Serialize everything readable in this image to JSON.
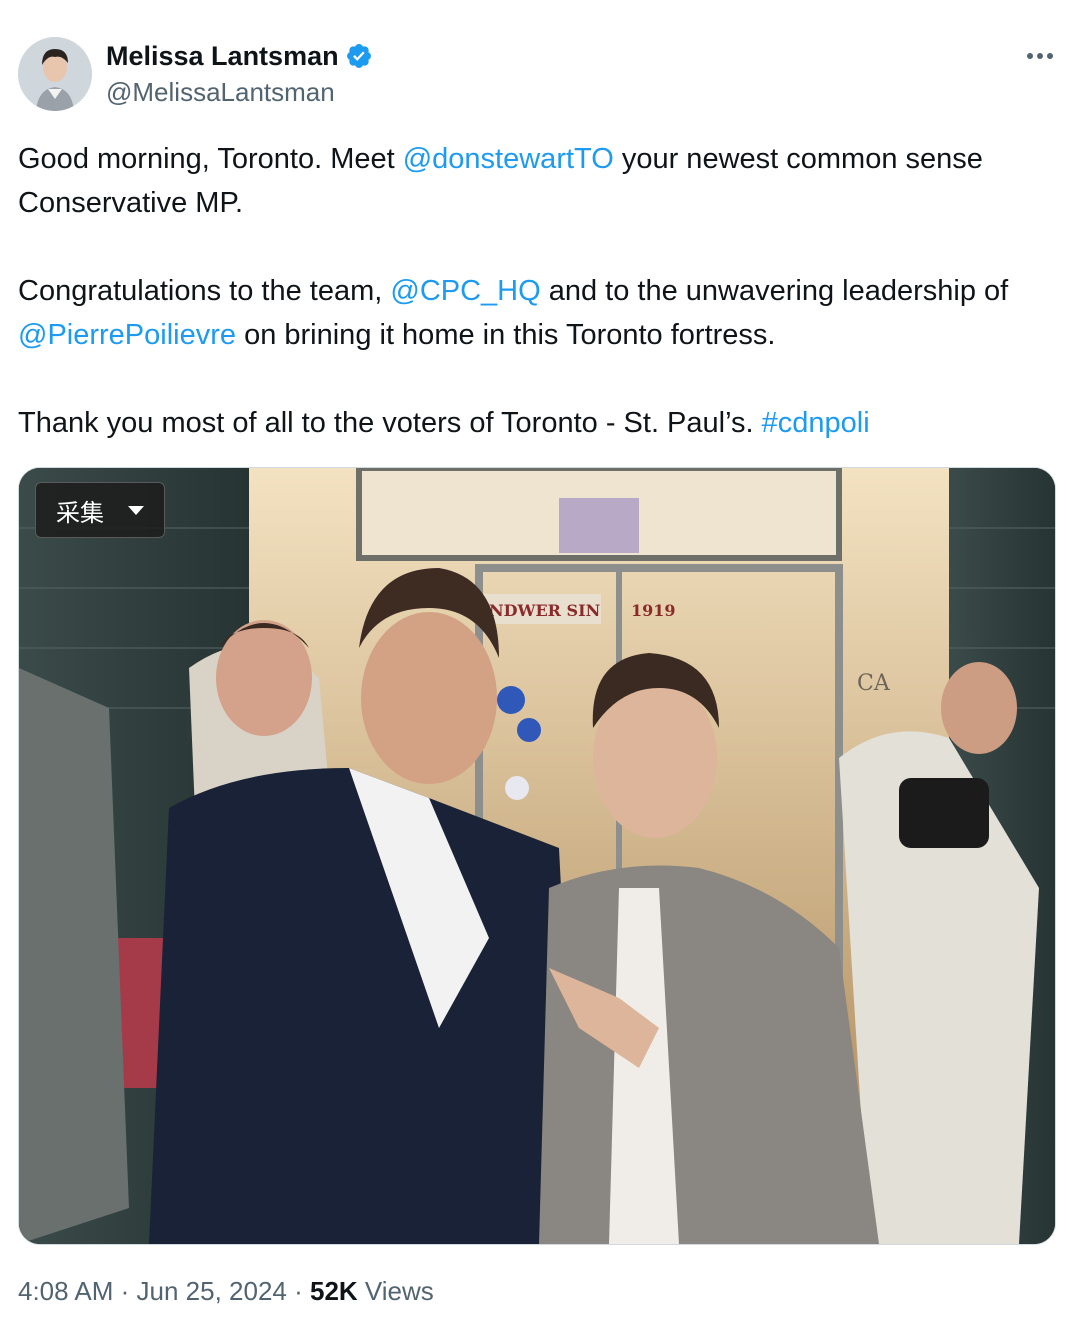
{
  "author": {
    "display_name": "Melissa Lantsman",
    "handle": "@MelissaLantsman"
  },
  "tweet": {
    "p1_a": "Good morning, Toronto. Meet ",
    "p1_mention": "@donstewartTO",
    "p1_b": " your newest common sense Conservative MP.",
    "p2_a": "Congratulations to the team, ",
    "p2_mention1": "@CPC_HQ",
    "p2_b": " and to the unwavering leadership of ",
    "p2_mention2": "@PierrePoilievre",
    "p2_c": " on brining it home in this Toronto fortress.",
    "p3_a": "Thank you most of all to the voters of Toronto - St. Paul’s. ",
    "p3_hashtag": "#cdnpoli"
  },
  "photo": {
    "collect_label": "采集",
    "sign_text": "NDWER SIN",
    "sign_year": "1919",
    "side_sign": "CA"
  },
  "meta": {
    "time": "4:08 AM",
    "sep1": " · ",
    "date": "Jun 25, 2024",
    "sep2": " · ",
    "views_count": "52K",
    "views_label": " Views"
  },
  "colors": {
    "link": "#1d9bf0",
    "verified": "#1d9bf0",
    "secondary_text": "#536471"
  },
  "icons": [
    "verified-badge-icon",
    "more-options-icon",
    "dropdown-caret-icon"
  ]
}
